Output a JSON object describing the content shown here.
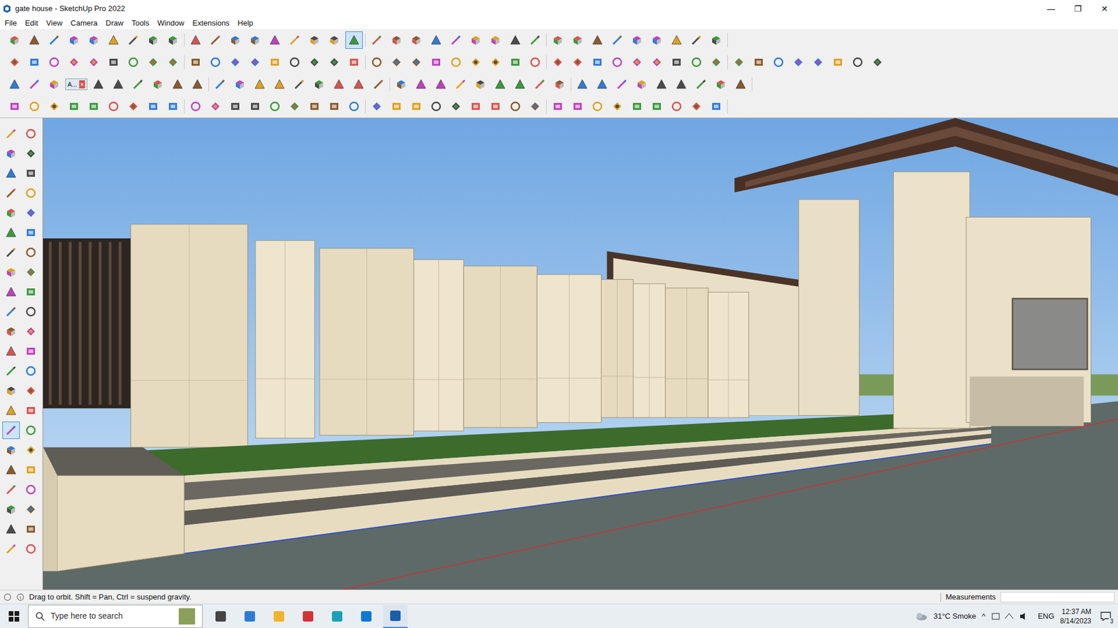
{
  "window": {
    "title": "gate house - SketchUp Pro 2022",
    "controls": [
      "—",
      "❐",
      "✕"
    ]
  },
  "menu": [
    "File",
    "Edit",
    "View",
    "Camera",
    "Draw",
    "Tools",
    "Window",
    "Extensions",
    "Help"
  ],
  "toolbars": [
    {
      "tools": [
        {
          "selected": false
        },
        {
          "selected": false
        },
        {
          "selected": false
        },
        {
          "selected": false
        },
        {
          "selected": false
        },
        {
          "selected": false
        },
        {
          "selected": false
        },
        {
          "selected": false
        },
        {
          "selected": false
        },
        {
          "selected": false
        },
        {
          "selected": false
        },
        {
          "selected": false
        },
        {
          "selected": false
        },
        {
          "selected": false
        },
        {
          "selected": false
        },
        {
          "selected": false
        },
        {
          "selected": false
        },
        {
          "selected": true
        },
        {
          "selected": false
        },
        {
          "selected": false
        },
        {
          "selected": false
        },
        {
          "selected": false
        },
        {
          "selected": false
        },
        {
          "selected": false
        },
        {
          "selected": false
        },
        {
          "selected": false
        },
        {
          "selected": false
        },
        {
          "selected": false
        },
        {
          "selected": false
        },
        {
          "selected": false
        },
        {
          "selected": false
        },
        {
          "selected": false
        },
        {
          "selected": false
        },
        {
          "selected": false
        },
        {
          "selected": false
        },
        {
          "selected": false
        }
      ]
    },
    {
      "tools": [
        {
          "selected": false
        },
        {
          "selected": false
        },
        {
          "selected": false
        },
        {
          "selected": false
        },
        {
          "selected": false
        },
        {
          "selected": false
        },
        {
          "selected": false
        },
        {
          "selected": false
        },
        {
          "selected": false
        },
        {
          "selected": false
        },
        {
          "selected": false
        },
        {
          "selected": false
        },
        {
          "selected": false
        },
        {
          "selected": false
        },
        {
          "selected": false
        },
        {
          "selected": false
        },
        {
          "selected": false
        },
        {
          "selected": false
        },
        {
          "selected": false
        },
        {
          "selected": false
        },
        {
          "selected": false
        },
        {
          "selected": false
        },
        {
          "selected": false
        },
        {
          "selected": false
        },
        {
          "selected": false
        },
        {
          "selected": false
        },
        {
          "selected": false
        },
        {
          "selected": false
        },
        {
          "selected": false
        },
        {
          "selected": false
        },
        {
          "selected": false
        },
        {
          "selected": false
        },
        {
          "selected": false
        },
        {
          "selected": false
        },
        {
          "selected": false
        },
        {
          "selected": false
        },
        {
          "selected": false
        },
        {
          "selected": false
        },
        {
          "selected": false
        },
        {
          "selected": false
        },
        {
          "selected": false
        },
        {
          "selected": false
        },
        {
          "selected": false
        },
        {
          "selected": false
        }
      ]
    },
    {
      "tools": [
        {
          "selected": false
        },
        {
          "selected": false
        },
        {
          "selected": false
        },
        {
          "selected": false
        },
        {
          "selected": false
        },
        {
          "selected": false
        },
        {
          "selected": false
        },
        {
          "selected": false
        },
        {
          "selected": false
        },
        {
          "selected": false
        },
        {
          "selected": false
        },
        {
          "selected": false
        },
        {
          "selected": false
        },
        {
          "selected": false
        },
        {
          "selected": false
        },
        {
          "selected": false
        },
        {
          "selected": false
        },
        {
          "selected": false
        },
        {
          "selected": false
        },
        {
          "selected": false
        },
        {
          "selected": false
        },
        {
          "selected": false
        },
        {
          "selected": false
        },
        {
          "selected": false
        },
        {
          "selected": false
        },
        {
          "selected": false
        },
        {
          "selected": false
        },
        {
          "selected": false
        },
        {
          "selected": false
        },
        {
          "selected": false
        },
        {
          "selected": false
        },
        {
          "selected": false
        },
        {
          "selected": false
        },
        {
          "selected": false
        },
        {
          "selected": false
        },
        {
          "selected": false
        }
      ]
    },
    {
      "tools": [
        {
          "selected": false
        },
        {
          "selected": false
        },
        {
          "selected": false
        },
        {
          "selected": false
        },
        {
          "selected": false
        },
        {
          "selected": false
        },
        {
          "selected": false
        },
        {
          "selected": false
        },
        {
          "selected": false
        },
        {
          "selected": false
        },
        {
          "selected": false
        },
        {
          "selected": false
        },
        {
          "selected": false
        },
        {
          "selected": false
        },
        {
          "selected": false
        },
        {
          "selected": false
        },
        {
          "selected": false
        },
        {
          "selected": false
        },
        {
          "selected": false
        },
        {
          "selected": false
        },
        {
          "selected": false
        },
        {
          "selected": false
        },
        {
          "selected": false
        },
        {
          "selected": false
        },
        {
          "selected": false
        },
        {
          "selected": false
        },
        {
          "selected": false
        },
        {
          "selected": false
        },
        {
          "selected": false
        },
        {
          "selected": false
        },
        {
          "selected": false
        },
        {
          "selected": false
        },
        {
          "selected": false
        },
        {
          "selected": false
        },
        {
          "selected": false
        },
        {
          "selected": false
        }
      ]
    }
  ],
  "floating_toolbar": {
    "title": "A...",
    "close": "×"
  },
  "tool_palette": [
    {
      "selected": false
    },
    {
      "selected": false
    },
    {
      "selected": false
    },
    {
      "selected": false
    },
    {
      "selected": false
    },
    {
      "selected": false
    },
    {
      "selected": false
    },
    {
      "selected": false
    },
    {
      "selected": false
    },
    {
      "selected": false
    },
    {
      "selected": false
    },
    {
      "selected": false
    },
    {
      "selected": false
    },
    {
      "selected": false
    },
    {
      "selected": false
    },
    {
      "selected": false
    },
    {
      "selected": false
    },
    {
      "selected": false
    },
    {
      "selected": false
    },
    {
      "selected": false
    },
    {
      "selected": false
    },
    {
      "selected": false
    },
    {
      "selected": false
    },
    {
      "selected": false
    },
    {
      "selected": false
    },
    {
      "selected": false
    },
    {
      "selected": false
    },
    {
      "selected": false
    },
    {
      "selected": false
    },
    {
      "selected": false
    },
    {
      "selected": true
    },
    {
      "selected": false
    },
    {
      "selected": false
    },
    {
      "selected": false
    },
    {
      "selected": false
    },
    {
      "selected": false
    },
    {
      "selected": false
    },
    {
      "selected": false
    },
    {
      "selected": false
    },
    {
      "selected": false
    },
    {
      "selected": false
    },
    {
      "selected": false
    },
    {
      "selected": false
    },
    {
      "selected": false
    }
  ],
  "status_bar": {
    "hint": "Drag to orbit. Shift = Pan, Ctrl = suspend gravity.",
    "measurements_label": "Measurements"
  },
  "taskbar": {
    "search_placeholder": "Type here to search",
    "weather": "31°C Smoke",
    "tray_arrow": "^",
    "language": "ENG",
    "time": "12:37 AM",
    "date": "8/14/2023",
    "notifications": "3"
  }
}
